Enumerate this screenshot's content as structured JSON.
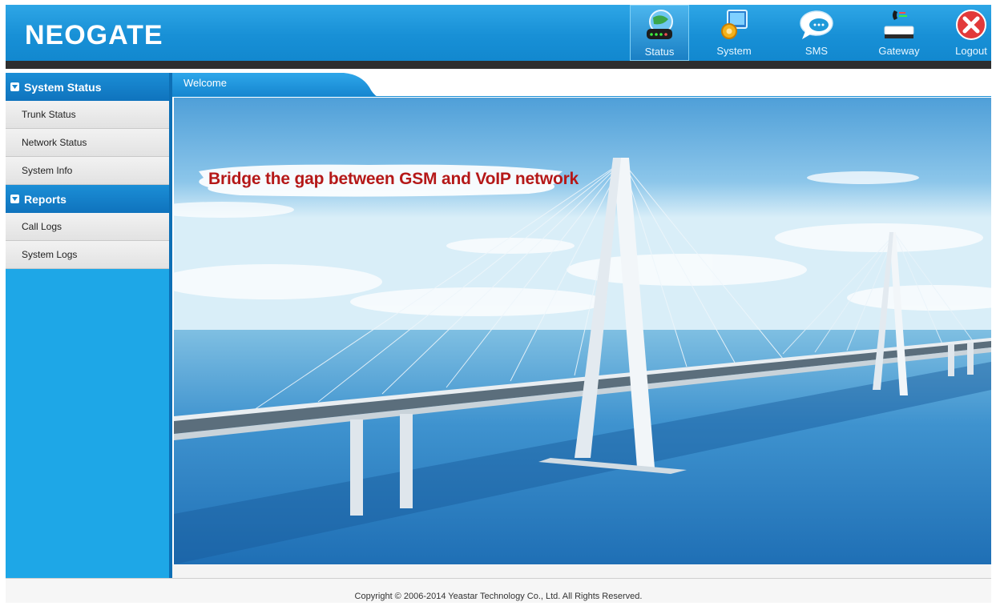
{
  "header": {
    "logo": "NEOGATE",
    "nav": [
      {
        "label": "Status",
        "icon": "globe-router-icon",
        "active": true
      },
      {
        "label": "System",
        "icon": "monitor-gear-icon"
      },
      {
        "label": "SMS",
        "icon": "chat-bubble-icon"
      },
      {
        "label": "Gateway",
        "icon": "gateway-device-icon"
      },
      {
        "label": "Logout",
        "icon": "close-circle-icon"
      }
    ]
  },
  "sidebar": {
    "sections": [
      {
        "title": "System Status",
        "items": [
          "Trunk Status",
          "Network Status",
          "System Info"
        ]
      },
      {
        "title": "Reports",
        "items": [
          "Call Logs",
          "System Logs"
        ]
      }
    ]
  },
  "main": {
    "tab": "Welcome",
    "banner": "Bridge the gap between GSM and VoIP network"
  },
  "footer": {
    "copyright": "Copyright © 2006-2014 Yeastar Technology Co., Ltd. All Rights Reserved."
  },
  "colors": {
    "header_blue": "#1890d6",
    "sidebar_blue": "#1ea7e7",
    "banner_red": "#b51818"
  }
}
